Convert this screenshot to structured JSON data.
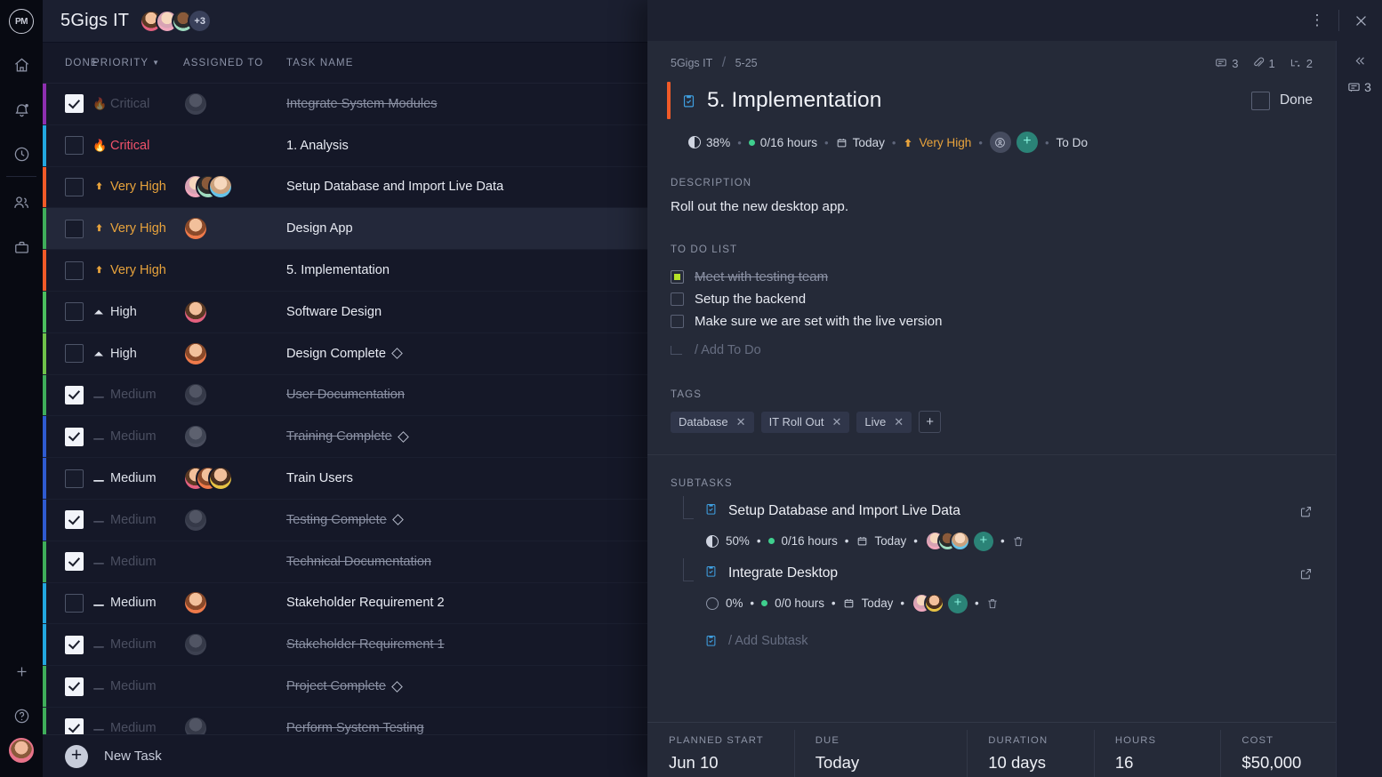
{
  "app": {
    "logo_text": "PM",
    "rail_icons": [
      "home-icon",
      "bell-icon",
      "clock-icon",
      "people-icon",
      "briefcase-icon"
    ],
    "rail_bottom_icons": [
      "add-icon",
      "help-icon",
      "user-avatar"
    ]
  },
  "header": {
    "project_title": "5Gigs IT",
    "avatar_overflow": "+3",
    "views": [
      {
        "name": "list-view",
        "active": true
      },
      {
        "name": "board-view",
        "active": false
      },
      {
        "name": "gantt-view",
        "active": false
      }
    ]
  },
  "list": {
    "columns": [
      "DONE",
      "PRIORITY",
      "ASSIGNED TO",
      "TASK NAME"
    ],
    "sort_column": "PRIORITY",
    "footer_label": "New Task",
    "rows": [
      {
        "done": true,
        "priority": "Critical",
        "prio_icon": "fire-icon",
        "prio_color": "#8b91a4",
        "dim": true,
        "task": "Integrate System Modules",
        "strike": true,
        "milestone": false,
        "bar": "#8e2fb0",
        "assignees": [
          "fg"
        ],
        "selected": false
      },
      {
        "done": false,
        "priority": "Critical",
        "prio_icon": "fire-icon",
        "prio_color": "#f2526b",
        "dim": false,
        "task": "1. Analysis",
        "strike": false,
        "milestone": false,
        "bar": "#22a7e0",
        "assignees": [],
        "selected": false
      },
      {
        "done": false,
        "priority": "Very High",
        "prio_icon": "up-arrow-icon",
        "prio_color": "#e8a33c",
        "dim": false,
        "task": "Setup Database and Import Live Data",
        "strike": false,
        "milestone": false,
        "bar": "#f05a28",
        "assignees": [
          "f2",
          "f3",
          "f5"
        ],
        "selected": false
      },
      {
        "done": false,
        "priority": "Very High",
        "prio_icon": "up-arrow-icon",
        "prio_color": "#e8a33c",
        "dim": false,
        "task": "Design App",
        "strike": false,
        "milestone": false,
        "bar": "#3fae5a",
        "assignees": [
          "f4"
        ],
        "selected": true
      },
      {
        "done": false,
        "priority": "Very High",
        "prio_icon": "up-arrow-icon",
        "prio_color": "#e8a33c",
        "dim": false,
        "task": "5. Implementation",
        "strike": false,
        "milestone": false,
        "bar": "#f05a28",
        "assignees": [],
        "selected": false
      },
      {
        "done": false,
        "priority": "High",
        "prio_icon": "triangle-up-icon",
        "prio_color": "#dde1ea",
        "dim": false,
        "task": "Software Design",
        "strike": false,
        "milestone": false,
        "bar": "#4bbf5e",
        "assignees": [
          "f1"
        ],
        "selected": false
      },
      {
        "done": false,
        "priority": "High",
        "prio_icon": "triangle-up-icon",
        "prio_color": "#dde1ea",
        "dim": false,
        "task": "Design Complete",
        "strike": false,
        "milestone": true,
        "bar": "#6fc24a",
        "assignees": [
          "f4"
        ],
        "selected": false
      },
      {
        "done": true,
        "priority": "Medium",
        "prio_icon": "dash-icon",
        "prio_color": "#8b91a4",
        "dim": true,
        "task": "User Documentation",
        "strike": true,
        "milestone": false,
        "bar": "#3fae5a",
        "assignees": [
          "fg"
        ],
        "selected": false
      },
      {
        "done": true,
        "priority": "Medium",
        "prio_icon": "dash-icon",
        "prio_color": "#8b91a4",
        "dim": true,
        "task": "Training Complete",
        "strike": true,
        "milestone": true,
        "bar": "#2f5bd0",
        "assignees": [
          "fg2"
        ],
        "selected": false
      },
      {
        "done": false,
        "priority": "Medium",
        "prio_icon": "dash-icon",
        "prio_color": "#dde1ea",
        "dim": false,
        "task": "Train Users",
        "strike": false,
        "milestone": false,
        "bar": "#2f5bd0",
        "assignees": [
          "f1",
          "f4",
          "f6"
        ],
        "selected": false
      },
      {
        "done": true,
        "priority": "Medium",
        "prio_icon": "dash-icon",
        "prio_color": "#8b91a4",
        "dim": true,
        "task": "Testing Complete",
        "strike": true,
        "milestone": true,
        "bar": "#2f5bd0",
        "assignees": [
          "fg"
        ],
        "selected": false
      },
      {
        "done": true,
        "priority": "Medium",
        "prio_icon": "dash-icon",
        "prio_color": "#8b91a4",
        "dim": true,
        "task": "Technical Documentation",
        "strike": true,
        "milestone": false,
        "bar": "#3fae5a",
        "assignees": [],
        "selected": false
      },
      {
        "done": false,
        "priority": "Medium",
        "prio_icon": "dash-icon",
        "prio_color": "#dde1ea",
        "dim": false,
        "task": "Stakeholder Requirement 2",
        "strike": false,
        "milestone": false,
        "bar": "#22a7e0",
        "assignees": [
          "f4"
        ],
        "selected": false
      },
      {
        "done": true,
        "priority": "Medium",
        "prio_icon": "dash-icon",
        "prio_color": "#8b91a4",
        "dim": true,
        "task": "Stakeholder Requirement 1",
        "strike": true,
        "milestone": false,
        "bar": "#22a7e0",
        "assignees": [
          "fg"
        ],
        "selected": false
      },
      {
        "done": true,
        "priority": "Medium",
        "prio_icon": "dash-icon",
        "prio_color": "#8b91a4",
        "dim": true,
        "task": "Project Complete",
        "strike": true,
        "milestone": true,
        "bar": "#3fae5a",
        "assignees": [],
        "selected": false
      },
      {
        "done": true,
        "priority": "Medium",
        "prio_icon": "dash-icon",
        "prio_color": "#8b91a4",
        "dim": true,
        "task": "Perform System Testing",
        "strike": true,
        "milestone": false,
        "bar": "#3fae5a",
        "assignees": [
          "fg"
        ],
        "selected": false
      }
    ]
  },
  "detail": {
    "breadcrumb_project": "5Gigs IT",
    "breadcrumb_id": "5-25",
    "counts": {
      "comments": "3",
      "attachments": "1",
      "dependencies": "2"
    },
    "title": "5. Implementation",
    "accent_color": "#f05a28",
    "done_label": "Done",
    "done_checked": false,
    "meta": {
      "progress": "38%",
      "hours": "0/16 hours",
      "due": "Today",
      "priority": "Very High",
      "status": "To Do"
    },
    "description": {
      "label": "DESCRIPTION",
      "text": "Roll out the new desktop app."
    },
    "todo": {
      "label": "TO DO LIST",
      "items": [
        {
          "text": "Meet with testing team",
          "done": true
        },
        {
          "text": "Setup the backend",
          "done": false
        },
        {
          "text": "Make sure we are set with the live version",
          "done": false
        }
      ],
      "add_placeholder": "/ Add To Do"
    },
    "tags": {
      "label": "TAGS",
      "items": [
        "Database",
        "IT Roll Out",
        "Live"
      ],
      "add_label": "+"
    },
    "subtasks": {
      "label": "SUBTASKS",
      "add_placeholder": "/ Add Subtask",
      "items": [
        {
          "title": "Setup Database and Import Live Data",
          "progress": "50%",
          "hours": "0/16 hours",
          "due": "Today",
          "assignees": [
            "f2",
            "f3",
            "f5"
          ]
        },
        {
          "title": "Integrate Desktop",
          "progress": "0%",
          "hours": "0/0 hours",
          "due": "Today",
          "assignees": [
            "f2",
            "f6"
          ]
        }
      ]
    },
    "stats": [
      {
        "label": "PLANNED START",
        "value": "Jun 10"
      },
      {
        "label": "DUE",
        "value": "Today"
      },
      {
        "label": "DURATION",
        "value": "10 days"
      },
      {
        "label": "HOURS",
        "value": "16"
      },
      {
        "label": "COST",
        "value": "$50,000"
      }
    ],
    "side_rail": {
      "collapse_icon": "chevrons-left-icon",
      "comment_count": "3"
    }
  }
}
